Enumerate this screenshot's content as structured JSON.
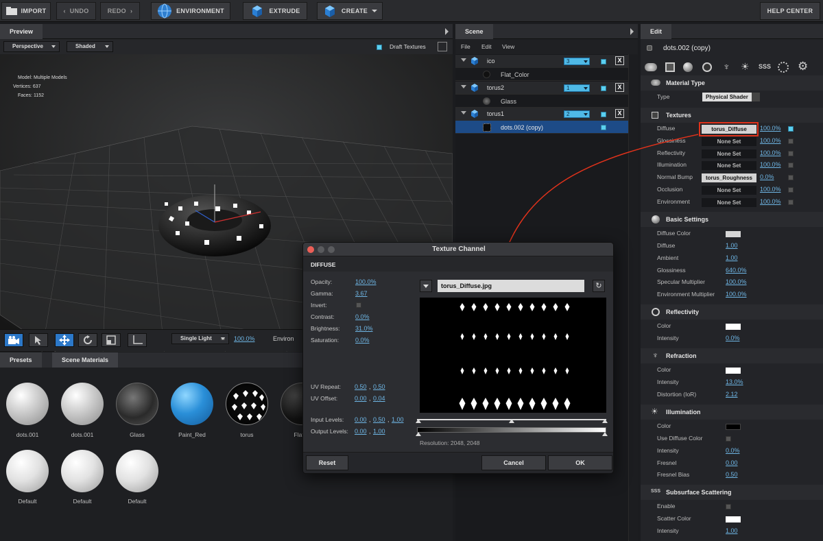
{
  "toolbar": {
    "import": "IMPORT",
    "undo": "UNDO",
    "redo": "REDO",
    "environment": "ENVIRONMENT",
    "extrude": "EXTRUDE",
    "create": "CREATE",
    "help": "HELP CENTER"
  },
  "preview": {
    "tab": "Preview",
    "camera": "Perspective",
    "shading": "Shaded",
    "draft_textures": "Draft Textures",
    "stats": {
      "model_label": "Model:",
      "model_value": "Multiple Models",
      "vertices_label": "Vertices:",
      "vertices_value": "637",
      "faces_label": "Faces:",
      "faces_value": "1152"
    },
    "light": "Single Light",
    "light_pct": "100.0%",
    "environment_label": "Environ"
  },
  "scene": {
    "tab": "Scene",
    "menu": [
      "File",
      "Edit",
      "View"
    ],
    "objects": [
      {
        "name": "ico",
        "layer": "3",
        "material": "Flat_Color"
      },
      {
        "name": "torus2",
        "layer": "1",
        "material": "Glass"
      },
      {
        "name": "torus1",
        "layer": "2",
        "material": "dots.002 (copy)"
      }
    ],
    "close": "X"
  },
  "edit": {
    "tab": "Edit",
    "material_name": "dots.002 (copy)",
    "material_type": {
      "title": "Material Type",
      "type_label": "Type",
      "type_value": "Physical Shader"
    },
    "textures": {
      "title": "Textures",
      "rows": [
        {
          "label": "Diffuse",
          "value": "torus_Diffuse",
          "pct": "100.0%"
        },
        {
          "label": "Glossiness",
          "value": "None Set",
          "pct": "100.0%"
        },
        {
          "label": "Reflectivity",
          "value": "None Set",
          "pct": "100.0%"
        },
        {
          "label": "Illumination",
          "value": "None Set",
          "pct": "100.0%"
        },
        {
          "label": "Normal Bump",
          "value": "torus_Roughness",
          "pct": "0.0%"
        },
        {
          "label": "Occlusion",
          "value": "None Set",
          "pct": "100.0%"
        },
        {
          "label": "Environment",
          "value": "None Set",
          "pct": "100.0%"
        }
      ]
    },
    "basic": {
      "title": "Basic Settings",
      "diffuse_color": "Diffuse Color",
      "diffuse": "Diffuse",
      "diffuse_v": "1.00",
      "ambient": "Ambient",
      "ambient_v": "1.00",
      "glossiness": "Glossiness",
      "glossiness_v": "640.0%",
      "spec_mult": "Specular Multiplier",
      "spec_mult_v": "100.0%",
      "env_mult": "Environment Multiplier",
      "env_mult_v": "100.0%"
    },
    "reflectivity": {
      "title": "Reflectivity",
      "color": "Color",
      "intensity": "Intensity",
      "intensity_v": "0.0%"
    },
    "refraction": {
      "title": "Refraction",
      "color": "Color",
      "intensity": "Intensity",
      "intensity_v": "13.0%",
      "distortion": "Distortion (IoR)",
      "distortion_v": "2.12"
    },
    "illumination": {
      "title": "Illumination",
      "color": "Color",
      "use_diffuse": "Use Diffuse Color",
      "intensity": "Intensity",
      "intensity_v": "0.0%",
      "fresnel": "Fresnel",
      "fresnel_v": "0.00",
      "fresnel_bias": "Fresnel Bias",
      "fresnel_bias_v": "0.50"
    },
    "sss": {
      "title": "Subsurface Scattering",
      "enable": "Enable",
      "scatter_color": "Scatter Color",
      "intensity": "Intensity",
      "intensity_v": "1.00"
    }
  },
  "dialog": {
    "title": "Texture Channel",
    "section": "DIFFUSE",
    "opacity": "Opacity:",
    "opacity_v": "100.0%",
    "gamma": "Gamma:",
    "gamma_v": "3.67",
    "invert": "Invert:",
    "contrast": "Contrast:",
    "contrast_v": "0.0%",
    "brightness": "Brightness:",
    "brightness_v": "31.0%",
    "saturation": "Saturation:",
    "saturation_v": "0.0%",
    "uv_repeat": "UV Repeat:",
    "uv_repeat_a": "0.50",
    "uv_repeat_b": "0.50",
    "uv_offset": "UV Offset:",
    "uv_offset_a": "0.00",
    "uv_offset_b": "0.04",
    "input_levels": "Input Levels:",
    "in_a": "0.00",
    "in_b": "0.50",
    "in_c": "1.00",
    "output_levels": "Output Levels:",
    "out_a": "0.00",
    "out_b": "1.00",
    "file": "torus_Diffuse.jpg",
    "resolution": "Resolution: 2048, 2048",
    "reset": "Reset",
    "cancel": "Cancel",
    "ok": "OK"
  },
  "materials": {
    "tab_presets": "Presets",
    "tab_scene": "Scene Materials",
    "items": [
      "dots.001",
      "dots.001",
      "Glass",
      "Paint_Red",
      "torus",
      "Flat_",
      "Default",
      "Default",
      "Default"
    ]
  },
  "colors": {
    "accent": "#4fb9e6",
    "selection": "#1d4b87",
    "highlight": "#e0321b"
  }
}
